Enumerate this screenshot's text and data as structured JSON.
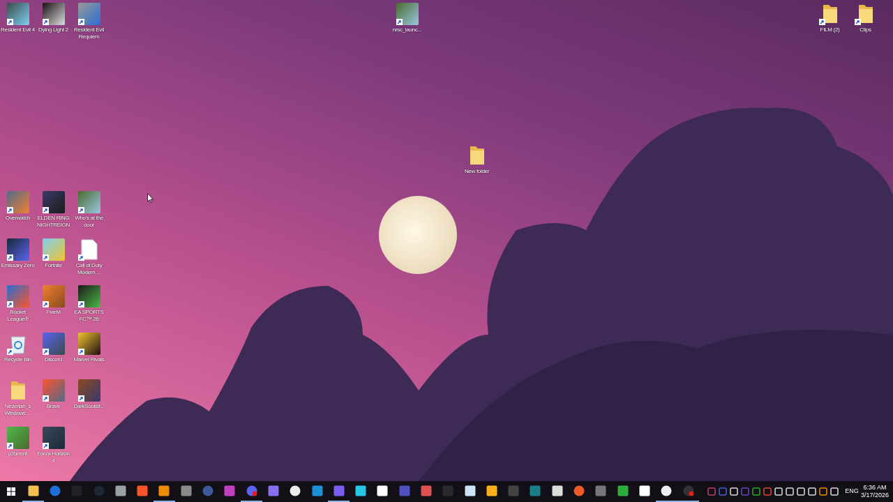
{
  "desktop": {
    "top_left": [
      {
        "label": "Resident Evil 4",
        "kind": "app",
        "shortcut": true
      },
      {
        "label": "Dying Light 2",
        "kind": "app",
        "shortcut": true
      },
      {
        "label": "Resident Evil Requiem",
        "kind": "app",
        "shortcut": true
      }
    ],
    "top_center": [
      {
        "label": "nrsc_launc...",
        "kind": "app",
        "shortcut": true
      }
    ],
    "center": [
      {
        "label": "New folder",
        "kind": "folder",
        "shortcut": false
      }
    ],
    "top_right": [
      {
        "label": "FILM (2)",
        "kind": "folder",
        "shortcut": true
      },
      {
        "label": "Clips",
        "kind": "folder",
        "shortcut": true
      }
    ],
    "left_grid": [
      {
        "label": "Overwatch",
        "kind": "app",
        "shortcut": true
      },
      {
        "label": "ELDEN RING NIGHTREIGN",
        "kind": "app",
        "shortcut": true
      },
      {
        "label": "Who's at the door",
        "kind": "app",
        "shortcut": true
      },
      {
        "label": "Emissary Zero",
        "kind": "app",
        "shortcut": true
      },
      {
        "label": "Fortnite",
        "kind": "app",
        "shortcut": true
      },
      {
        "label": "Call of Duty Modern ...",
        "kind": "document",
        "shortcut": true
      },
      {
        "label": "Rocket League®",
        "kind": "app",
        "shortcut": true
      },
      {
        "label": "FiveM",
        "kind": "app",
        "shortcut": true
      },
      {
        "label": "EA SPORTS FC™ 26",
        "kind": "app",
        "shortcut": true
      },
      {
        "label": "Recycle Bin",
        "kind": "recycle-bin",
        "shortcut": true
      },
      {
        "label": "Discord",
        "kind": "app",
        "shortcut": true
      },
      {
        "label": "Marvel Rivals",
        "kind": "app",
        "shortcut": true
      },
      {
        "label": "Nezeriah_s Windows ...",
        "kind": "folder",
        "shortcut": false
      },
      {
        "label": "Brave",
        "kind": "app",
        "shortcut": true
      },
      {
        "label": "DarkSoulsII...",
        "kind": "app",
        "shortcut": true
      },
      {
        "label": "µTorrent",
        "kind": "app",
        "shortcut": true
      },
      {
        "label": "Forza Horizon 4",
        "kind": "app",
        "shortcut": true
      }
    ]
  },
  "taskbar": {
    "apps": [
      {
        "running": true
      },
      {
        "running": false
      },
      {
        "running": false
      },
      {
        "running": false
      },
      {
        "running": false
      },
      {
        "running": false
      },
      {
        "running": true
      },
      {
        "running": false
      },
      {
        "running": false
      },
      {
        "running": false
      },
      {
        "running": true
      },
      {
        "running": false
      },
      {
        "running": false
      },
      {
        "running": false
      },
      {
        "running": true
      },
      {
        "running": false
      },
      {
        "running": false
      },
      {
        "running": false
      },
      {
        "running": false
      },
      {
        "running": false
      },
      {
        "running": false
      },
      {
        "running": false
      },
      {
        "running": false
      },
      {
        "running": false
      },
      {
        "running": false
      },
      {
        "running": false
      },
      {
        "running": false
      },
      {
        "running": false
      },
      {
        "running": false
      },
      {
        "running": true
      },
      {
        "running": true
      }
    ],
    "language": "ENG",
    "time": "6:36 AM",
    "date": "3/17/2026"
  }
}
